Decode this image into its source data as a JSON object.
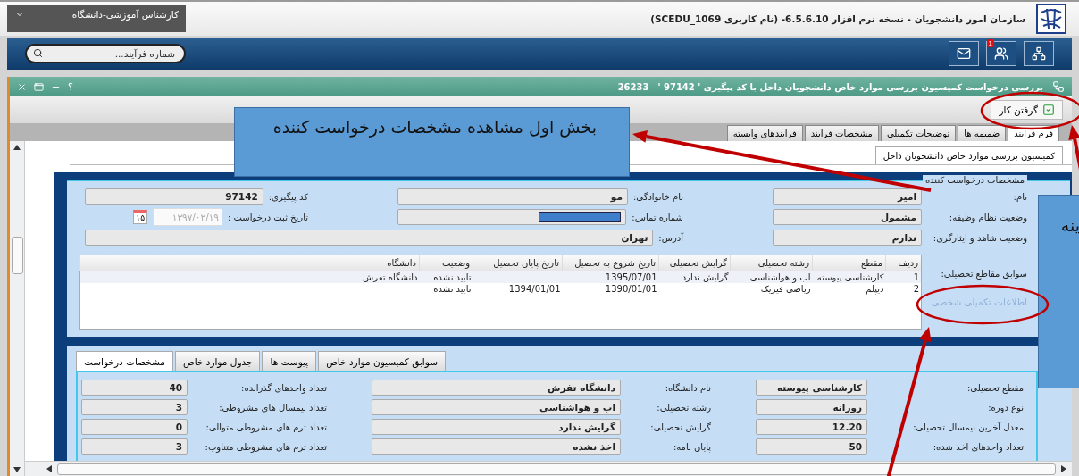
{
  "header": {
    "title": "سازمان امور دانشجویان - نسخه نرم افزار 6.5.6.10- (نام کاربری SCEDU_1069)",
    "role": "کارشناس آموزشی-دانشگاه"
  },
  "nav": {
    "badge": "1",
    "search": {
      "placeholder": "شماره فرآیند..."
    }
  },
  "window": {
    "title": "بررسی درخواست کمیسیون بررسی موارد خاص دانشجویان داخل با کد پیگیری ' 97142 '",
    "code": "26233",
    "help": "؟"
  },
  "toolbar": {
    "buttons": [
      "گرفتن کار"
    ]
  },
  "tabs": [
    {
      "label": "فرم فرآیند",
      "selected": true
    },
    {
      "label": "ضمیمه ها",
      "selected": false
    },
    {
      "label": "توضیحات تکمیلی",
      "selected": false
    },
    {
      "label": "مشخصات فرایند",
      "selected": false
    },
    {
      "label": "فرایندهای وابسته",
      "selected": false
    }
  ],
  "subtab": {
    "label": "کمیسیون بررسی موارد خاص دانشجویان داخل"
  },
  "applicant": {
    "legend": "مشخصات درخواست کننده",
    "fields": [
      [
        {
          "kind": "text",
          "label": "نام:",
          "value": "امیر"
        },
        {
          "kind": "text",
          "label": "نام خانوادگی:",
          "value": "مو"
        },
        {
          "kind": "text",
          "label": "کد پیگیری:",
          "value": "97142"
        }
      ],
      [
        {
          "kind": "text",
          "label": "وضعیت نظام وظیفه:",
          "value": "مشمول"
        },
        {
          "kind": "masked",
          "label": "شماره تماس:"
        },
        {
          "kind": "date",
          "label": "تاریخ ثبت درخواست :",
          "value": "۱۳۹۷/۰۲/۱۹",
          "day": "۱۵",
          "disabled": true
        }
      ],
      [
        {
          "kind": "text",
          "label": "وضعیت شاهد و ایثارگری:",
          "value": "ندارم"
        },
        {
          "kind": "wide",
          "label": "آدرس:",
          "value": "تهران"
        }
      ]
    ],
    "history_label": "سوابق مقاطع تحصیلی:",
    "link": {
      "label": "اطلاعات تکمیلی شخصی",
      "disabled": true
    },
    "table": {
      "columns": [
        "ردیف",
        "مقطع",
        "رشته تحصیلی",
        "گرایش تحصیلی",
        "تاریخ شروع به تحصیل",
        "تاریخ پایان تحصیل",
        "وضعیت",
        "دانشگاه"
      ],
      "rows": [
        [
          "1",
          "کارشناسی پیوسته",
          "اب و هواشناسی",
          "گرایش ندارد",
          "1395/07/01",
          "",
          "تایید نشده",
          "دانشگاه تفرش"
        ],
        [
          "2",
          "دیپلم",
          "ریاضی فیزیک",
          "",
          "1390/01/01",
          "1394/01/01",
          "تایید نشده",
          ""
        ]
      ]
    }
  },
  "request": {
    "tabs": [
      {
        "label": "سوابق کمیسیون موارد خاص",
        "selected": false
      },
      {
        "label": "پیوست ها",
        "selected": false
      },
      {
        "label": "جدول موارد خاص",
        "selected": false
      },
      {
        "label": "مشخصات درخواست",
        "selected": true
      }
    ],
    "fields": [
      [
        {
          "label": "مقطع تحصیلی:",
          "value": "کارشناسی پیوسته"
        },
        {
          "label": "نام دانشگاه:",
          "value": "دانشگاه تفرش"
        },
        {
          "label": "تعداد واحدهای گذرانده:",
          "value": "40"
        }
      ],
      [
        {
          "label": "نوع دوره:",
          "value": "روزانه"
        },
        {
          "label": "رشته تحصیلی:",
          "value": "اب و هواشناسی"
        },
        {
          "label": "تعداد نیمسال های مشروطی:",
          "value": "3"
        }
      ],
      [
        {
          "label": "معدل آخرین نیمسال تحصیلی:",
          "value": "12.20"
        },
        {
          "label": "گرایش تحصیلی:",
          "value": "گرایش ندارد"
        },
        {
          "label": "تعداد ترم های مشروطی متوالی:",
          "value": "0"
        }
      ],
      [
        {
          "label": "تعداد واحدهای اخذ شده:",
          "value": "50"
        },
        {
          "label": "پایان نامه:",
          "value": "اخذ نشده"
        },
        {
          "label": "تعداد ترم های مشروطی متناوب:",
          "value": "3"
        }
      ]
    ]
  },
  "callouts": [
    {
      "text": "بخش اول مشاهده مشخصات درخواست کننده"
    },
    {
      "text": "ینه"
    }
  ]
}
